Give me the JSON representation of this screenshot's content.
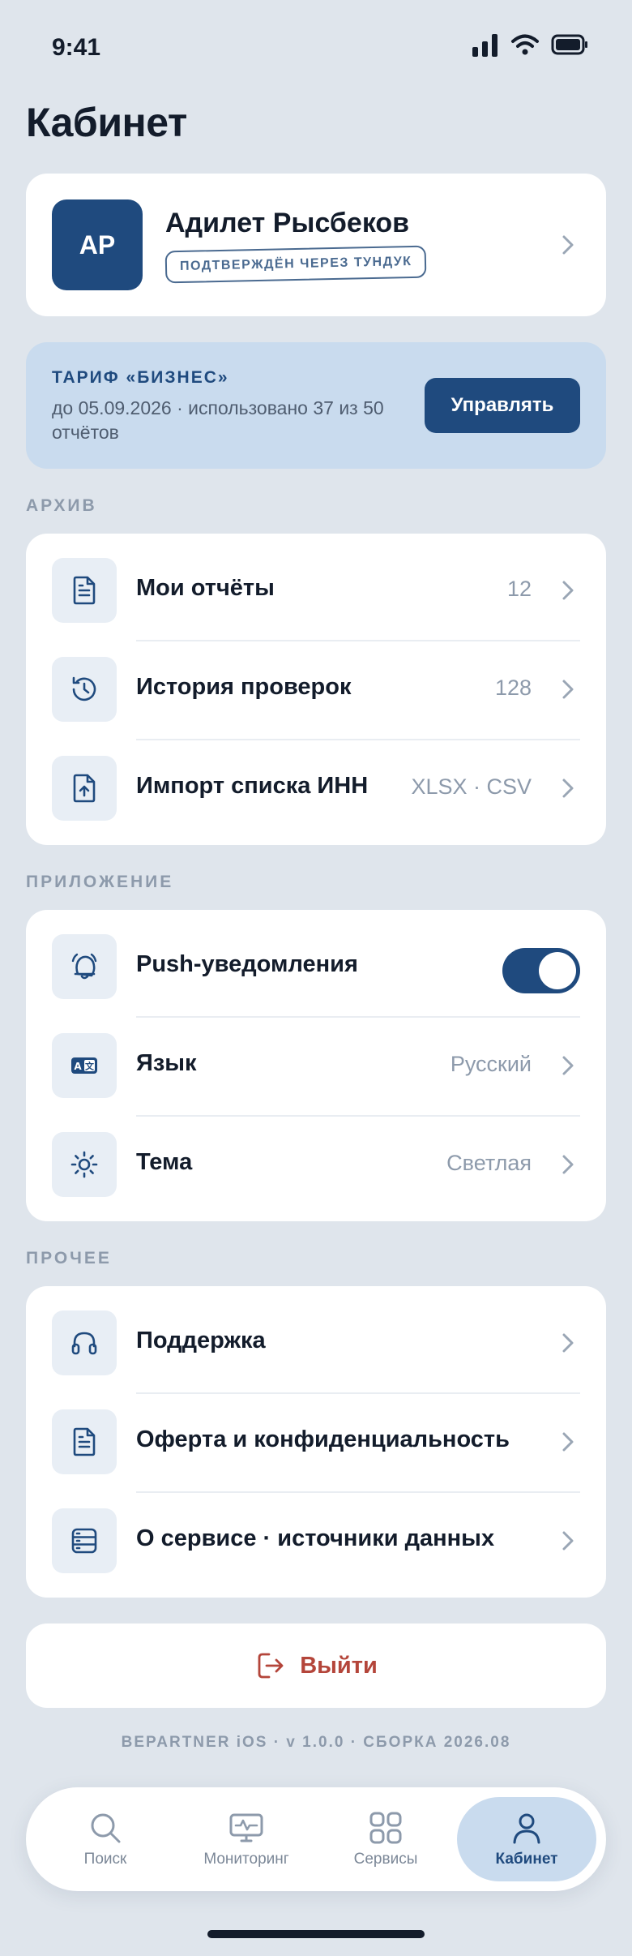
{
  "status_bar": {
    "time": "9:41",
    "icons": [
      "signal-icon",
      "wifi-icon",
      "battery-icon"
    ]
  },
  "page": {
    "title": "Кабинет"
  },
  "profile": {
    "initials": "АР",
    "name": "Адилет Рысбеков",
    "badge": "ПОДТВЕРЖДЁН ЧЕРЕЗ ТУНДУК"
  },
  "plan": {
    "title": "ТАРИФ «БИЗНЕС»",
    "description": "до 05.09.2026 · использовано 37 из 50 отчётов",
    "manage_label": "Управлять"
  },
  "sections": {
    "archive": {
      "label": "АРХИВ",
      "items": [
        {
          "label": "Мои отчёты",
          "value": "12",
          "icon": "document-icon"
        },
        {
          "label": "История проверок",
          "value": "128",
          "icon": "history-icon"
        },
        {
          "label": "Импорт списка ИНН",
          "value": "XLSX · CSV",
          "icon": "upload-file-icon"
        }
      ]
    },
    "app": {
      "label": "ПРИЛОЖЕНИЕ",
      "items": [
        {
          "label": "Push-уведомления",
          "toggle_on": true,
          "icon": "bell-icon"
        },
        {
          "label": "Язык",
          "value": "Русский",
          "icon": "language-icon"
        },
        {
          "label": "Тема",
          "value": "Светлая",
          "icon": "sun-icon"
        }
      ]
    },
    "other": {
      "label": "ПРОЧЕЕ",
      "items": [
        {
          "label": "Поддержка",
          "icon": "headset-icon"
        },
        {
          "label": "Оферта и конфиденциальность",
          "icon": "document-icon"
        },
        {
          "label": "О сервисе · источники данных",
          "icon": "database-icon"
        }
      ]
    }
  },
  "logout": {
    "label": "Выйти"
  },
  "version": "BEPARTNER iOS · v 1.0.0 · СБОРКА 2026.08",
  "tabbar": {
    "tabs": [
      {
        "label": "Поиск",
        "icon": "search-icon",
        "active": false
      },
      {
        "label": "Мониторинг",
        "icon": "monitor-icon",
        "active": false
      },
      {
        "label": "Сервисы",
        "icon": "grid-icon",
        "active": false
      },
      {
        "label": "Кабинет",
        "icon": "user-icon",
        "active": true
      }
    ]
  },
  "colors": {
    "accent": "#1f4a7e",
    "background": "#dfe5ec",
    "danger": "#b4453a",
    "plan_bg": "#c9dbee"
  }
}
